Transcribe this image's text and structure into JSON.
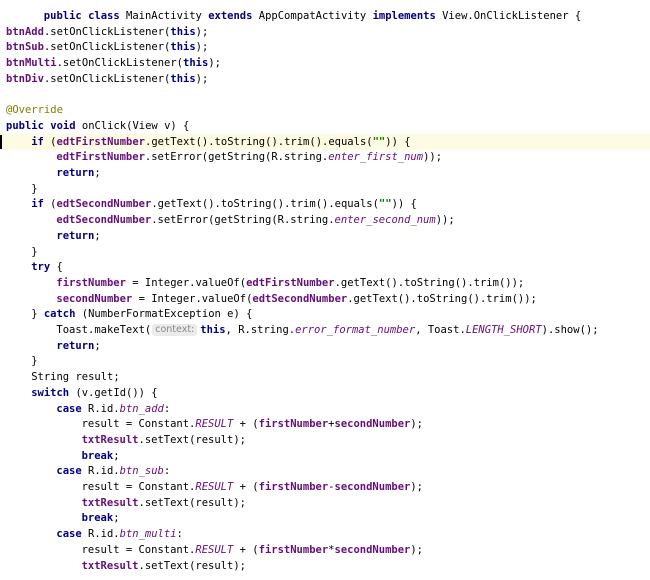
{
  "editor": {
    "lines": [
      {
        "indent": 6,
        "tokens": [
          {
            "t": "public",
            "c": "kw"
          },
          {
            "t": " "
          },
          {
            "t": "class",
            "c": "kw"
          },
          {
            "t": " MainActivity "
          },
          {
            "t": "extends",
            "c": "kw"
          },
          {
            "t": " AppCompatActivity "
          },
          {
            "t": "implements",
            "c": "kw"
          },
          {
            "t": " View.OnClickListener {"
          }
        ]
      },
      {
        "indent": 0,
        "tokens": [
          {
            "t": "btnAdd",
            "c": "field"
          },
          {
            "t": ".setOnClickListener("
          },
          {
            "t": "this",
            "c": "kw"
          },
          {
            "t": ");"
          }
        ]
      },
      {
        "indent": 0,
        "tokens": [
          {
            "t": "btnSub",
            "c": "field"
          },
          {
            "t": ".setOnClickListener("
          },
          {
            "t": "this",
            "c": "kw"
          },
          {
            "t": ");"
          }
        ]
      },
      {
        "indent": 0,
        "tokens": [
          {
            "t": "btnMulti",
            "c": "field"
          },
          {
            "t": ".setOnClickListener("
          },
          {
            "t": "this",
            "c": "kw"
          },
          {
            "t": ");"
          }
        ]
      },
      {
        "indent": 0,
        "tokens": [
          {
            "t": "btnDiv",
            "c": "field"
          },
          {
            "t": ".setOnClickListener("
          },
          {
            "t": "this",
            "c": "kw"
          },
          {
            "t": ");"
          }
        ]
      },
      {
        "indent": 0,
        "tokens": []
      },
      {
        "indent": 0,
        "tokens": [
          {
            "t": "@Override",
            "c": "ann"
          }
        ]
      },
      {
        "indent": 0,
        "tokens": [
          {
            "t": "public",
            "c": "kw"
          },
          {
            "t": " "
          },
          {
            "t": "void",
            "c": "kw"
          },
          {
            "t": " onClick(View v) {"
          }
        ]
      },
      {
        "indent": 4,
        "highlight": true,
        "caret": true,
        "tokens": [
          {
            "t": "if",
            "c": "kw"
          },
          {
            "t": " ("
          },
          {
            "t": "edtFirstNumber",
            "c": "field"
          },
          {
            "t": ".getText().toString().trim().equals("
          },
          {
            "t": "\"\"",
            "c": "str"
          },
          {
            "t": ")) {"
          }
        ]
      },
      {
        "indent": 8,
        "tokens": [
          {
            "t": "edtFirstNumber",
            "c": "field"
          },
          {
            "t": ".setError(getString(R.string."
          },
          {
            "t": "enter_first_num",
            "c": "res"
          },
          {
            "t": "));"
          }
        ]
      },
      {
        "indent": 8,
        "tokens": [
          {
            "t": "return",
            "c": "kw"
          },
          {
            "t": ";"
          }
        ]
      },
      {
        "indent": 4,
        "tokens": [
          {
            "t": "}"
          }
        ]
      },
      {
        "indent": 4,
        "tokens": [
          {
            "t": "if",
            "c": "kw"
          },
          {
            "t": " ("
          },
          {
            "t": "edtSecondNumber",
            "c": "field"
          },
          {
            "t": ".getText().toString().trim().equals("
          },
          {
            "t": "\"\"",
            "c": "str"
          },
          {
            "t": ")) {"
          }
        ]
      },
      {
        "indent": 8,
        "tokens": [
          {
            "t": "edtSecondNumber",
            "c": "field"
          },
          {
            "t": ".setError(getString(R.string."
          },
          {
            "t": "enter_second_num",
            "c": "res"
          },
          {
            "t": "));"
          }
        ]
      },
      {
        "indent": 8,
        "tokens": [
          {
            "t": "return",
            "c": "kw"
          },
          {
            "t": ";"
          }
        ]
      },
      {
        "indent": 4,
        "tokens": [
          {
            "t": "}"
          }
        ]
      },
      {
        "indent": 4,
        "tokens": [
          {
            "t": "try",
            "c": "kw"
          },
          {
            "t": " {"
          }
        ]
      },
      {
        "indent": 8,
        "tokens": [
          {
            "t": "firstNumber",
            "c": "field"
          },
          {
            "t": " = Integer."
          },
          {
            "t": "valueOf"
          },
          {
            "t": "("
          },
          {
            "t": "edtFirstNumber",
            "c": "field"
          },
          {
            "t": ".getText().toString().trim());"
          }
        ]
      },
      {
        "indent": 8,
        "tokens": [
          {
            "t": "secondNumber",
            "c": "field"
          },
          {
            "t": " = Integer."
          },
          {
            "t": "valueOf"
          },
          {
            "t": "("
          },
          {
            "t": "edtSecondNumber",
            "c": "field"
          },
          {
            "t": ".getText().toString().trim());"
          }
        ]
      },
      {
        "indent": 4,
        "tokens": [
          {
            "t": "} "
          },
          {
            "t": "catch",
            "c": "kw"
          },
          {
            "t": " (NumberFormatException e) {"
          }
        ]
      },
      {
        "indent": 8,
        "tokens": [
          {
            "t": "Toast."
          },
          {
            "t": "makeText"
          },
          {
            "t": "("
          },
          {
            "t": "context:",
            "c": "hint"
          },
          {
            "t": "this",
            "c": "kw"
          },
          {
            "t": ", R.string."
          },
          {
            "t": "error_format_number",
            "c": "res"
          },
          {
            "t": ", Toast."
          },
          {
            "t": "LENGTH_SHORT",
            "c": "sfield"
          },
          {
            "t": ").show();"
          }
        ]
      },
      {
        "indent": 8,
        "tokens": [
          {
            "t": "return",
            "c": "kw"
          },
          {
            "t": ";"
          }
        ]
      },
      {
        "indent": 4,
        "tokens": [
          {
            "t": "}"
          }
        ]
      },
      {
        "indent": 4,
        "tokens": [
          {
            "t": "String result;"
          }
        ]
      },
      {
        "indent": 4,
        "tokens": [
          {
            "t": "switch",
            "c": "kw"
          },
          {
            "t": " (v.getId()) {"
          }
        ]
      },
      {
        "indent": 8,
        "tokens": [
          {
            "t": "case",
            "c": "kw"
          },
          {
            "t": " R.id."
          },
          {
            "t": "btn_add",
            "c": "res"
          },
          {
            "t": ":"
          }
        ]
      },
      {
        "indent": 12,
        "tokens": [
          {
            "t": "result = Constant."
          },
          {
            "t": "RESULT",
            "c": "sfield"
          },
          {
            "t": " + ("
          },
          {
            "t": "firstNumber",
            "c": "field"
          },
          {
            "t": "+"
          },
          {
            "t": "secondNumber",
            "c": "field"
          },
          {
            "t": ");"
          }
        ]
      },
      {
        "indent": 12,
        "tokens": [
          {
            "t": "txtResult",
            "c": "field"
          },
          {
            "t": ".setText(result);"
          }
        ]
      },
      {
        "indent": 12,
        "tokens": [
          {
            "t": "break",
            "c": "kw"
          },
          {
            "t": ";"
          }
        ]
      },
      {
        "indent": 8,
        "tokens": [
          {
            "t": "case",
            "c": "kw"
          },
          {
            "t": " R.id."
          },
          {
            "t": "btn_sub",
            "c": "res"
          },
          {
            "t": ":"
          }
        ]
      },
      {
        "indent": 12,
        "tokens": [
          {
            "t": "result = Constant."
          },
          {
            "t": "RESULT",
            "c": "sfield"
          },
          {
            "t": " + ("
          },
          {
            "t": "firstNumber",
            "c": "field"
          },
          {
            "t": "-"
          },
          {
            "t": "secondNumber",
            "c": "field"
          },
          {
            "t": ");"
          }
        ]
      },
      {
        "indent": 12,
        "tokens": [
          {
            "t": "txtResult",
            "c": "field"
          },
          {
            "t": ".setText(result);"
          }
        ]
      },
      {
        "indent": 12,
        "tokens": [
          {
            "t": "break",
            "c": "kw"
          },
          {
            "t": ";"
          }
        ]
      },
      {
        "indent": 8,
        "tokens": [
          {
            "t": "case",
            "c": "kw"
          },
          {
            "t": " R.id."
          },
          {
            "t": "btn_multi",
            "c": "res"
          },
          {
            "t": ":"
          }
        ]
      },
      {
        "indent": 12,
        "tokens": [
          {
            "t": "result = Constant."
          },
          {
            "t": "RESULT",
            "c": "sfield"
          },
          {
            "t": " + ("
          },
          {
            "t": "firstNumber",
            "c": "field"
          },
          {
            "t": "*"
          },
          {
            "t": "secondNumber",
            "c": "field"
          },
          {
            "t": ");"
          }
        ]
      },
      {
        "indent": 12,
        "tokens": [
          {
            "t": "txtResult",
            "c": "field"
          },
          {
            "t": ".setText(result);"
          }
        ]
      }
    ]
  }
}
